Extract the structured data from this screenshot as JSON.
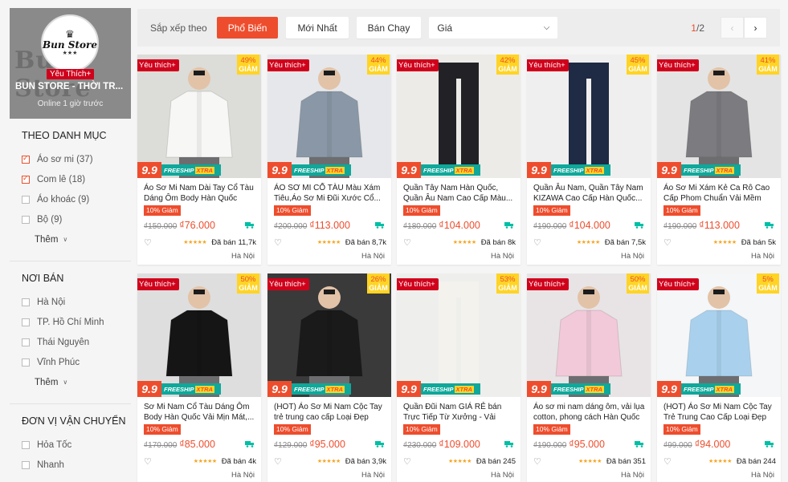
{
  "shop": {
    "logo_text": "Bun Store",
    "logo_dots": "★★★",
    "bg_text": "Bun Store",
    "preferred_label": "Yêu Thích+",
    "name": "BUN STORE - THỜI TR...",
    "online": "Online 1 giờ trước"
  },
  "filters": {
    "category": {
      "title": "THEO DANH MỤC",
      "items": [
        {
          "label": "Áo sơ mi (37)",
          "checked": true
        },
        {
          "label": "Com lê (18)",
          "checked": true
        },
        {
          "label": "Áo khoác (9)",
          "checked": false
        },
        {
          "label": "Bộ (9)",
          "checked": false
        }
      ],
      "more_label": "Thêm"
    },
    "location": {
      "title": "NƠI BÁN",
      "items": [
        {
          "label": "Hà Nội"
        },
        {
          "label": "TP. Hồ Chí Minh"
        },
        {
          "label": "Thái Nguyên"
        },
        {
          "label": "Vĩnh Phúc"
        }
      ],
      "more_label": "Thêm"
    },
    "shipping": {
      "title": "ĐƠN VỊ VẬN CHUYỂN",
      "items": [
        {
          "label": "Hỏa Tốc"
        },
        {
          "label": "Nhanh"
        }
      ]
    }
  },
  "sort": {
    "label": "Sắp xếp theo",
    "options": [
      "Phổ Biến",
      "Mới Nhất",
      "Bán Chạy"
    ],
    "active": "Phổ Biến",
    "price_label": "Giá"
  },
  "pager": {
    "current": "1",
    "total": "/2",
    "prev": "‹",
    "next": "›"
  },
  "badges": {
    "preferred": "Yêu thích+",
    "discount_word": "GIẢM",
    "nine": "9.9",
    "freeship": "FREESHIP",
    "xtra": "XTRA",
    "discount_tag": "10% Giảm"
  },
  "products": [
    {
      "title": "Áo Sơ Mi Nam Dài Tay Cổ Tàu Dáng Ôm Body Hàn Quốc Vải...",
      "discount": "49%",
      "old_price": "₫150.000",
      "price": "₫76.000",
      "sold": "Đã bán 11,7k",
      "location": "Hà Nội",
      "shirt_color": "#f7f7f5",
      "bg": "#dcdcd8"
    },
    {
      "title": "ÁO SƠ MI CỔ TÀU Màu Xám Tiêu,Áo Sơ Mi Đũi Xước Cổ...",
      "discount": "44%",
      "old_price": "₫200.000",
      "price": "₫113.000",
      "sold": "Đã bán 8,7k",
      "location": "Hà Nội",
      "shirt_color": "#8a97a6",
      "bg": "#e6e7ea"
    },
    {
      "title": "Quần Tây Nam Hàn Quốc, Quần Âu Nam Cao Cấp Màu...",
      "discount": "42%",
      "old_price": "₫180.000",
      "price": "₫104.000",
      "sold": "Đã bán 8k",
      "location": "Hà Nội",
      "shirt_color": "#222226",
      "bg": "#ecebe8"
    },
    {
      "title": "Quần Âu Nam, Quần Tây Nam KIZAWA Cao Cấp Hàn Quốc...",
      "discount": "45%",
      "old_price": "₫190.000",
      "price": "₫104.000",
      "sold": "Đã bán 7,5k",
      "location": "Hà Nội",
      "shirt_color": "#1f2a44",
      "bg": "#efefef"
    },
    {
      "title": "Áo Sơ Mi Xám Kẻ Ca Rô Cao Cấp Phom Chuẩn Vải Mềm M...",
      "discount": "41%",
      "old_price": "₫190.000",
      "price": "₫113.000",
      "sold": "Đã bán 5k",
      "location": "Hà Nội",
      "shirt_color": "#7b7b80",
      "bg": "#e4e4e4"
    },
    {
      "title": "Sơ Mi Nam Cổ Tàu Dáng Ôm Body Hàn Quốc Vải Mịn Mát,...",
      "discount": "50%",
      "old_price": "₫170.000",
      "price": "₫85.000",
      "sold": "Đã bán 4k",
      "location": "Hà Nội",
      "shirt_color": "#151515",
      "bg": "#dedede"
    },
    {
      "title": "(HOT) Áo Sơ Mi Nam Cộc Tay trẻ trung cao cấp Loại Đẹp",
      "discount": "26%",
      "old_price": "₫129.000",
      "price": "₫95.000",
      "sold": "Đã bán 3,9k",
      "location": "Hà Nội",
      "shirt_color": "#1a1a1a",
      "bg": "#3a3a3a"
    },
    {
      "title": "Quần Đũi Nam GIÁ RẺ bán Trực Tiếp Từ Xưởng - Vải Đũi...",
      "discount": "53%",
      "old_price": "₫230.000",
      "price": "₫109.000",
      "sold": "Đã bán 245",
      "location": "Hà Nội",
      "shirt_color": "#f4f2ec",
      "bg": "#eeeeec"
    },
    {
      "title": "Áo sơ mi nam dáng ôm, vải lụa cotton, phong cách Hàn Quốc",
      "discount": "50%",
      "old_price": "₫190.000",
      "price": "₫95.000",
      "sold": "Đã bán 351",
      "location": "Hà Nội",
      "shirt_color": "#f1c9d8",
      "bg": "#e8e4e6"
    },
    {
      "title": "(HOT) Áo Sơ Mi Nam Cộc Tay Trẻ Trung Cao Cấp Loại Đẹp",
      "discount": "5%",
      "old_price": "₫99.000",
      "price": "₫94.000",
      "sold": "Đã bán 244",
      "location": "Hà Nội",
      "shirt_color": "#a9d1ee",
      "bg": "#f4f6f8"
    }
  ]
}
